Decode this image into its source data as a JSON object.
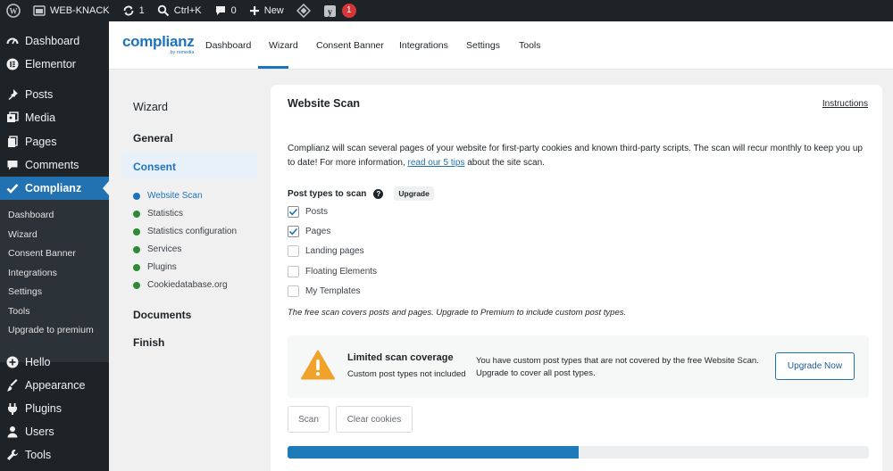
{
  "adminbar": {
    "site_name": "WEB-KNACK",
    "updates_count": "1",
    "search_shortcut": "Ctrl+K",
    "comments_count": "0",
    "new_label": "New",
    "notifications_count": "1"
  },
  "menu": {
    "items": [
      {
        "label": "Dashboard",
        "icon": "dashboard-icon"
      },
      {
        "label": "Elementor",
        "icon": "elementor-icon"
      },
      {
        "label": "Posts",
        "icon": "pin-icon"
      },
      {
        "label": "Media",
        "icon": "media-icon"
      },
      {
        "label": "Pages",
        "icon": "pages-icon"
      },
      {
        "label": "Comments",
        "icon": "comment-icon"
      },
      {
        "label": "Complianz",
        "icon": "check-icon"
      },
      {
        "label": "Hello",
        "icon": "plus-circle-icon"
      },
      {
        "label": "Appearance",
        "icon": "brush-icon"
      },
      {
        "label": "Plugins",
        "icon": "plugin-icon"
      },
      {
        "label": "Users",
        "icon": "user-icon"
      },
      {
        "label": "Tools",
        "icon": "wrench-icon"
      }
    ],
    "submenu": [
      "Dashboard",
      "Wizard",
      "Consent Banner",
      "Integrations",
      "Settings",
      "Tools",
      "Upgrade to premium"
    ]
  },
  "plugin_header": {
    "logo_word": "complianz",
    "logo_by": "by rsmedia",
    "tabs": [
      "Dashboard",
      "Wizard",
      "Consent Banner",
      "Integrations",
      "Settings",
      "Tools"
    ],
    "active_tab": "Wizard"
  },
  "wizard": {
    "title": "Wizard",
    "sections": [
      "General",
      "Consent",
      "Documents",
      "Finish"
    ],
    "steps": [
      "Website Scan",
      "Statistics",
      "Statistics configuration",
      "Services",
      "Plugins",
      "Cookiedatabase.org"
    ]
  },
  "scan": {
    "title": "Website Scan",
    "instructions": "Instructions",
    "desc_before": "Complianz will scan several pages of your website for first-party cookies and known third-party scripts. The scan will recur monthly to keep you up to date! For more information, ",
    "desc_link": "read our 5 tips",
    "desc_after": " about the site scan.",
    "post_types_label": "Post types to scan",
    "help_glyph": "?",
    "upgrade_tag": "Upgrade",
    "post_types": [
      {
        "label": "Posts",
        "checked": true
      },
      {
        "label": "Pages",
        "checked": true
      },
      {
        "label": "Landing pages",
        "checked": false
      },
      {
        "label": "Floating Elements",
        "checked": false
      },
      {
        "label": "My Templates",
        "checked": false
      }
    ],
    "note": "The free scan covers posts and pages. Upgrade to Premium to include custom post types.",
    "notice": {
      "title": "Limited scan coverage",
      "subtitle": "Custom post types not included",
      "text": "You have custom post types that are not covered by the free Website Scan. Upgrade to cover all post types.",
      "button": "Upgrade Now"
    },
    "scan_button": "Scan",
    "clear_button": "Clear cookies",
    "progress_percent": 50
  },
  "colors": {
    "admin_dark": "#1d2327",
    "accent_blue": "#2271b1",
    "success_green": "#2e8a37",
    "warning_orange": "#f0a22b"
  }
}
